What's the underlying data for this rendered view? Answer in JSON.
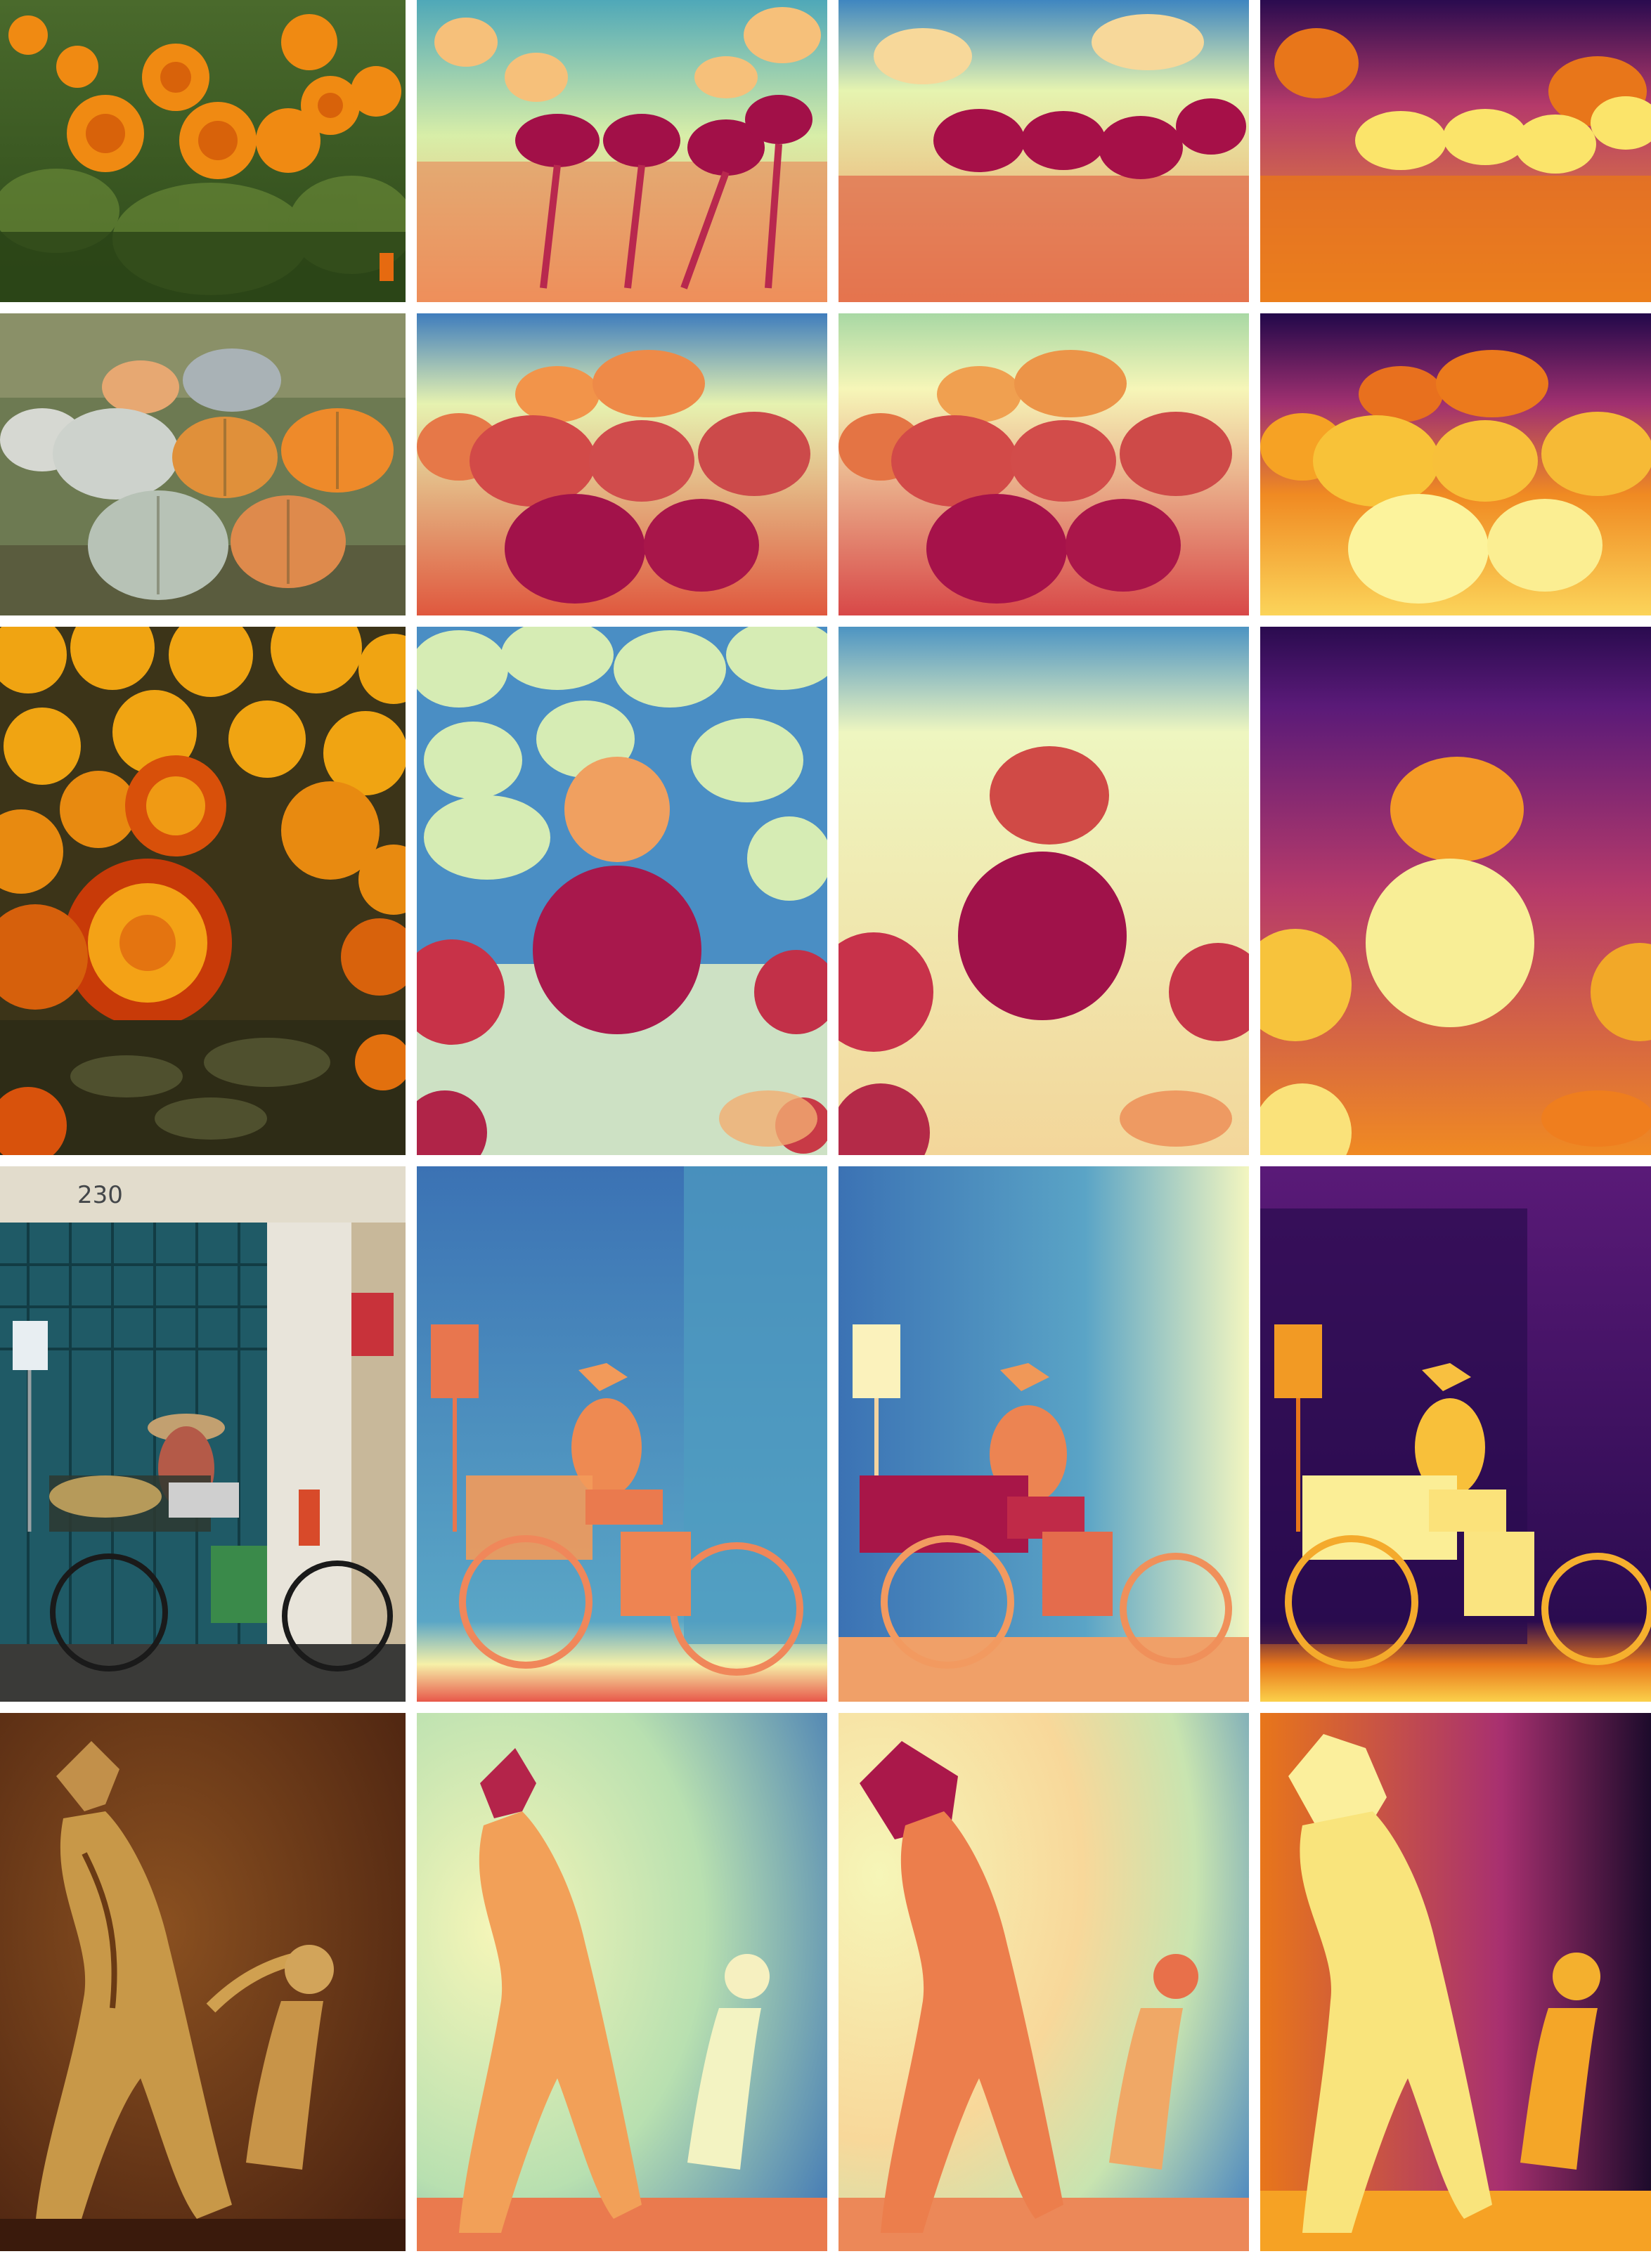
{
  "grid": {
    "rows": 5,
    "columns": 4,
    "column_order": [
      "photo",
      "depth-spectral",
      "depth-spectral-smooth",
      "depth-inferno"
    ]
  },
  "rows": [
    {
      "subject": "marigold-garden"
    },
    {
      "subject": "pumpkins"
    },
    {
      "subject": "marigold-closeup"
    },
    {
      "subject": "street-vendor-bicycle",
      "storefront_number": "230"
    },
    {
      "subject": "sepia-illustration"
    }
  ],
  "colors": {
    "spectral_far": "#3b7fbe",
    "spectral_mid": "#f6f8b8",
    "spectral_near": "#9e1147",
    "inferno_far": "#2a0b4f",
    "inferno_mid": "#e8761a",
    "inferno_near": "#fbf5a0"
  }
}
